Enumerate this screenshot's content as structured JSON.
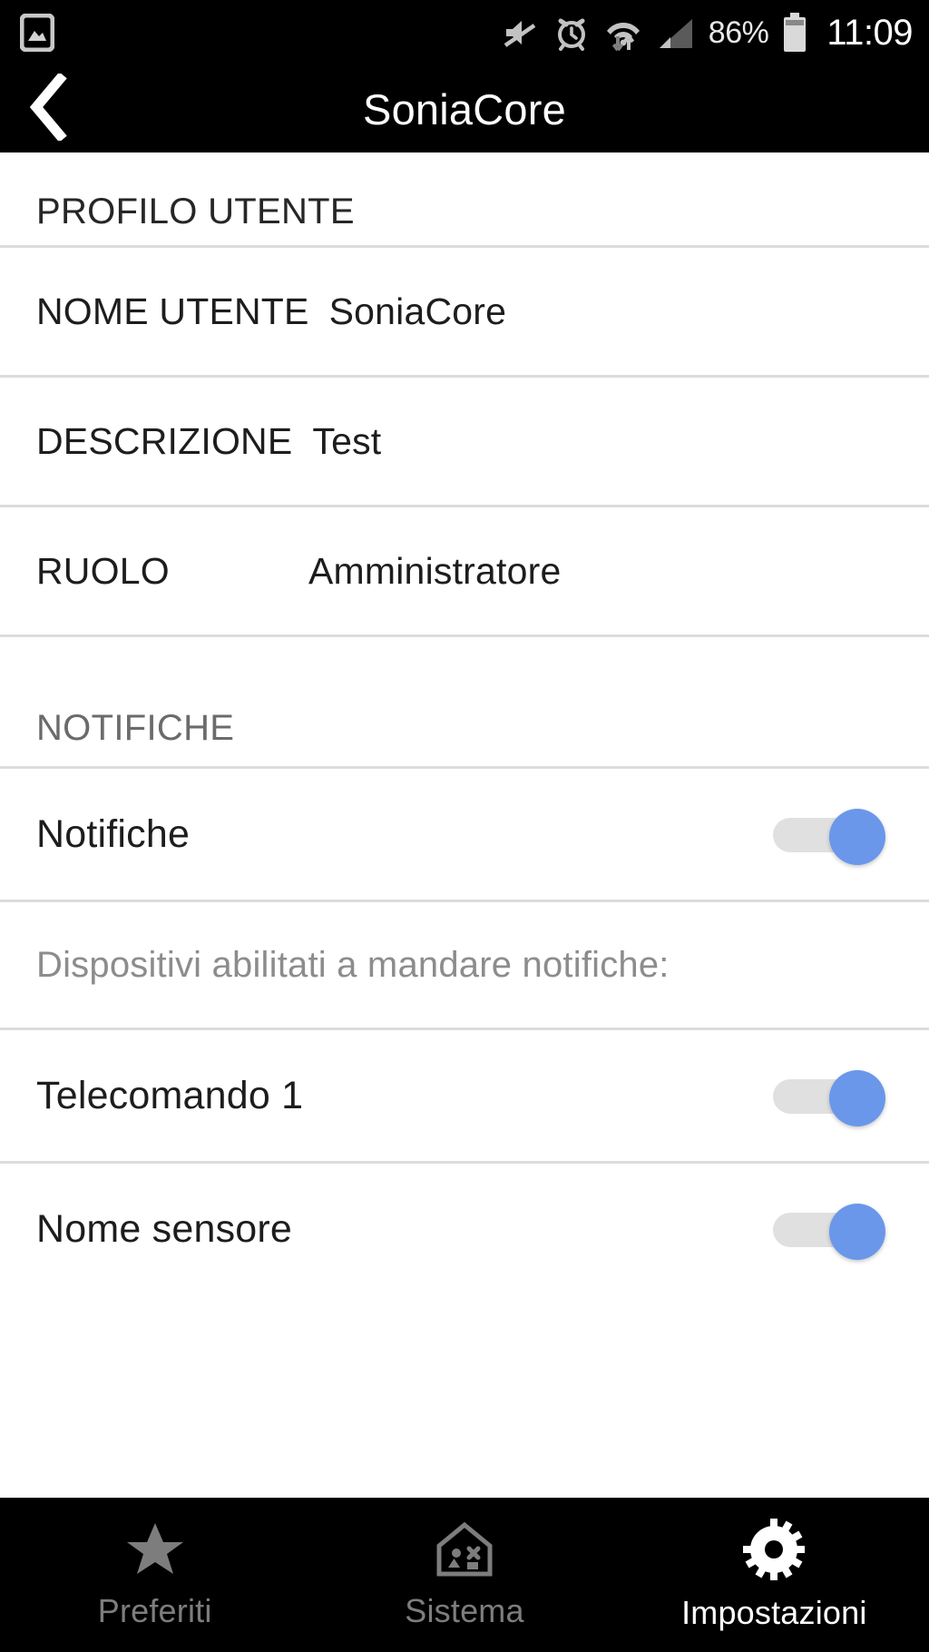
{
  "statusbar": {
    "left_icons": [
      {
        "name": "gallery-image-icon"
      }
    ],
    "right_icons": [
      {
        "name": "volume-mute-icon"
      },
      {
        "name": "alarm-clock-icon"
      },
      {
        "name": "wifi-data-transfer-icon"
      },
      {
        "name": "cellular-signal-icon"
      }
    ],
    "battery_percent": "86%",
    "battery_icon": "battery-icon",
    "clock": "11:09"
  },
  "appbar": {
    "back_icon": "back-chevron-icon",
    "title": "SoniaCore"
  },
  "profile_section": {
    "header": "PROFILO UTENTE",
    "rows": [
      {
        "label": "NOME UTENTE",
        "value": "SoniaCore"
      },
      {
        "label": "DESCRIZIONE",
        "value": "Test"
      },
      {
        "label": "RUOLO",
        "value": "Amministratore"
      }
    ]
  },
  "notifications_section": {
    "header": "NOTIFICHE",
    "main_toggle": {
      "label": "Notifiche",
      "state": "on"
    },
    "note": "Dispositivi abilitati a mandare notifiche:",
    "devices": [
      {
        "label": "Telecomando 1",
        "state": "on"
      },
      {
        "label": "Nome sensore",
        "state": "on"
      }
    ]
  },
  "bottomnav": {
    "items": [
      {
        "label": "Preferiti",
        "icon": "star-icon",
        "active": false
      },
      {
        "label": "Sistema",
        "icon": "house-icon",
        "active": false
      },
      {
        "label": "Impostazioni",
        "icon": "gear-icon",
        "active": true
      }
    ]
  },
  "colors": {
    "accent_blue": "#6a97ea",
    "track_gray": "#e0e0e0",
    "divider": "#dcdcdc",
    "muted_text": "#8c8c8c",
    "bar_black": "#000000"
  }
}
